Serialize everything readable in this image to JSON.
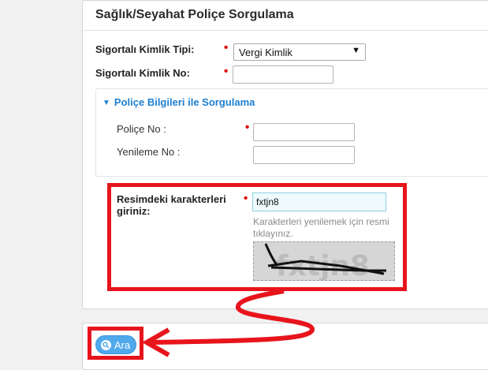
{
  "form": {
    "title": "Sağlık/Seyahat Poliçe Sorgulama",
    "required_mark": "•",
    "kimlik_tipi_label": "Sigortalı Kimlik Tipi:",
    "kimlik_tipi_value": "Vergi Kimlik",
    "kimlik_no_label": "Sigortalı Kimlik No:",
    "kimlik_no_value": ""
  },
  "policy_section": {
    "header": "Poliçe Bilgileri ile Sorgulama",
    "police_no_label": "Poliçe No :",
    "police_no_value": "",
    "yenileme_no_label": "Yenileme No :",
    "yenileme_no_value": ""
  },
  "captcha": {
    "label_line1": "Resimdeki karakterleri",
    "label_line2": "giriniz:",
    "input_value": "fxtjn8",
    "hint": "Karakterleri yenilemek için resmi tıklayınız.",
    "image_text": "fxtjn8"
  },
  "actions": {
    "search_label": "Ara"
  },
  "colors": {
    "annotation_red": "#e8141c",
    "link_blue": "#1e7fd2",
    "button_blue": "#4fa9eb",
    "required_red": "#e00000"
  },
  "icons": {
    "dropdown": "chevron-down-icon",
    "section_toggle": "triangle-down-icon",
    "search": "search-icon"
  }
}
